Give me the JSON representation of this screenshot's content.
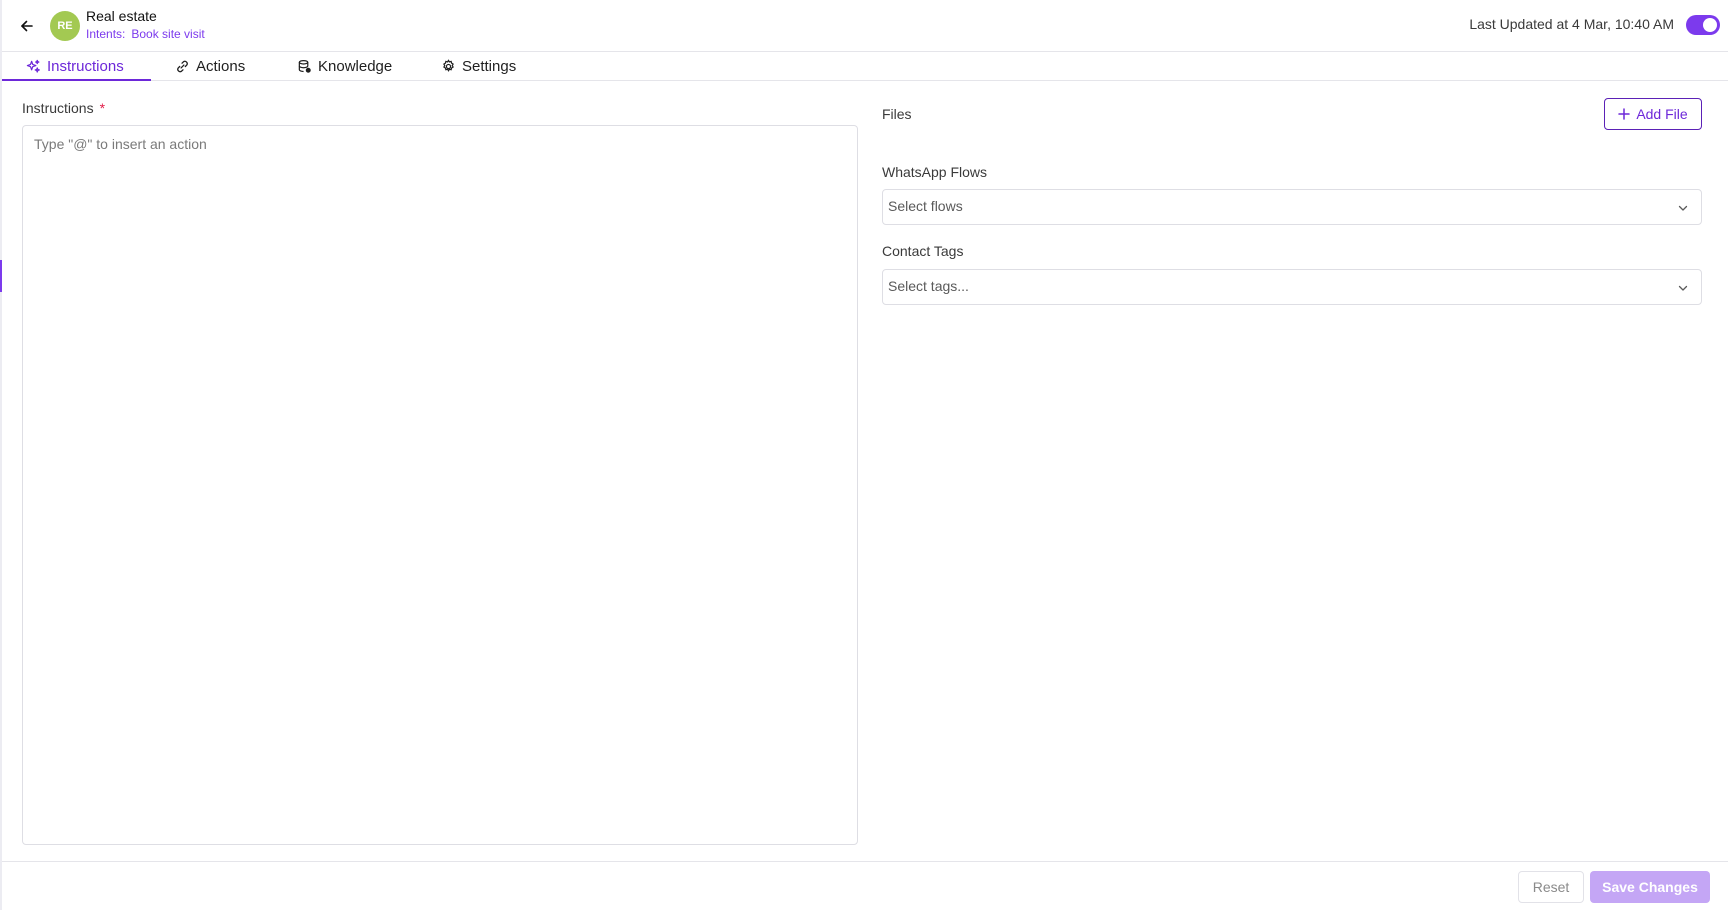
{
  "header": {
    "back_icon": "arrow-left-icon",
    "avatar_initials": "RE",
    "avatar_color": "#a3c952",
    "agent_name": "Real estate",
    "intents_label": "Intents:",
    "intent_value": "Book site visit",
    "last_updated": "Last Updated at 4 Mar, 10:40 AM",
    "active_toggle_on": true
  },
  "tabs": [
    {
      "label": "Instructions",
      "icon": "sparkles-icon",
      "active": true
    },
    {
      "label": "Actions",
      "icon": "link-icon",
      "active": false
    },
    {
      "label": "Knowledge",
      "icon": "database-icon",
      "active": false
    },
    {
      "label": "Settings",
      "icon": "gear-icon",
      "active": false
    }
  ],
  "instructions": {
    "label": "Instructions",
    "required_mark": "*",
    "placeholder": "Type \"@\" to insert an action",
    "value": ""
  },
  "files": {
    "label": "Files",
    "add_button": "Add File"
  },
  "whatsapp_flows": {
    "label": "WhatsApp Flows",
    "placeholder": "Select flows"
  },
  "contact_tags": {
    "label": "Contact Tags",
    "placeholder": "Select tags..."
  },
  "footer": {
    "reset_label": "Reset",
    "save_label": "Save Changes"
  },
  "colors": {
    "accent": "#6d28d9",
    "toggle": "#7c3aed",
    "save_disabled": "#c4a6f5",
    "required": "#e11d48"
  }
}
